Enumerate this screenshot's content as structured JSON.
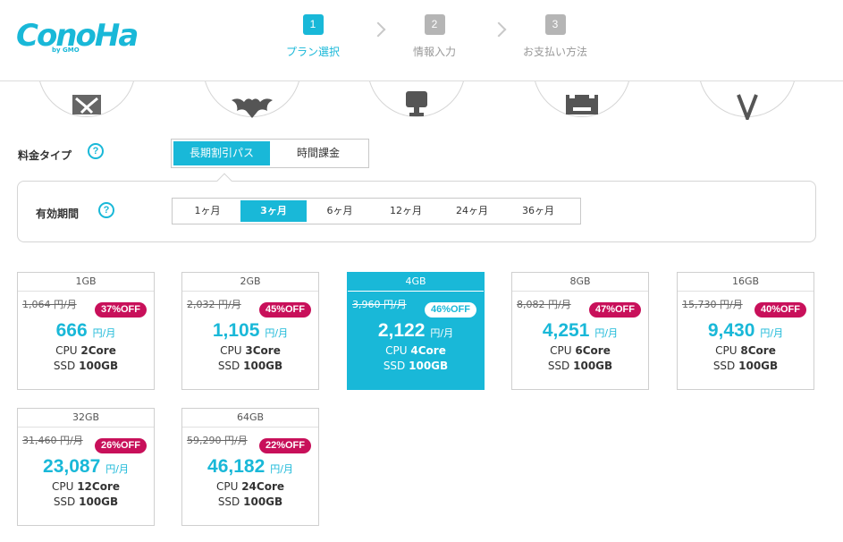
{
  "brand": {
    "name": "ConoHa",
    "sub": "by GMO"
  },
  "steps": [
    {
      "num": "1",
      "label": "プラン選択"
    },
    {
      "num": "2",
      "label": "情報入力"
    },
    {
      "num": "3",
      "label": "お支払い方法"
    }
  ],
  "os_icons": [
    "windows-icon",
    "bat-icon",
    "tree-icon",
    "box-icon",
    "vue-icon"
  ],
  "pricing": {
    "label": "料金タイプ",
    "help": "?",
    "options": [
      "長期割引パス",
      "時間課金"
    ]
  },
  "period": {
    "label": "有効期間",
    "help": "?",
    "options": [
      "1ヶ月",
      "3ヶ月",
      "6ヶ月",
      "12ヶ月",
      "24ヶ月",
      "36ヶ月"
    ]
  },
  "plans": [
    {
      "gb": "1GB",
      "old": "1,064 円/月",
      "discount": "37%OFF",
      "price": "666",
      "unit": "円/月",
      "cpu_label": "CPU",
      "cpu": "2Core",
      "ssd_label": "SSD",
      "ssd": "100GB"
    },
    {
      "gb": "2GB",
      "old": "2,032 円/月",
      "discount": "45%OFF",
      "price": "1,105",
      "unit": "円/月",
      "cpu_label": "CPU",
      "cpu": "3Core",
      "ssd_label": "SSD",
      "ssd": "100GB"
    },
    {
      "gb": "4GB",
      "old": "3,960 円/月",
      "discount": "46%OFF",
      "price": "2,122",
      "unit": "円/月",
      "cpu_label": "CPU",
      "cpu": "4Core",
      "ssd_label": "SSD",
      "ssd": "100GB"
    },
    {
      "gb": "8GB",
      "old": "8,082 円/月",
      "discount": "47%OFF",
      "price": "4,251",
      "unit": "円/月",
      "cpu_label": "CPU",
      "cpu": "6Core",
      "ssd_label": "SSD",
      "ssd": "100GB"
    },
    {
      "gb": "16GB",
      "old": "15,730 円/月",
      "discount": "40%OFF",
      "price": "9,430",
      "unit": "円/月",
      "cpu_label": "CPU",
      "cpu": "8Core",
      "ssd_label": "SSD",
      "ssd": "100GB"
    },
    {
      "gb": "32GB",
      "old": "31,460 円/月",
      "discount": "26%OFF",
      "price": "23,087",
      "unit": "円/月",
      "cpu_label": "CPU",
      "cpu": "12Core",
      "ssd_label": "SSD",
      "ssd": "100GB"
    },
    {
      "gb": "64GB",
      "old": "59,290 円/月",
      "discount": "22%OFF",
      "price": "46,182",
      "unit": "円/月",
      "cpu_label": "CPU",
      "cpu": "24Core",
      "ssd_label": "SSD",
      "ssd": "100GB"
    }
  ],
  "colors": {
    "accent": "#19b8d8",
    "badge": "#c8105a"
  }
}
